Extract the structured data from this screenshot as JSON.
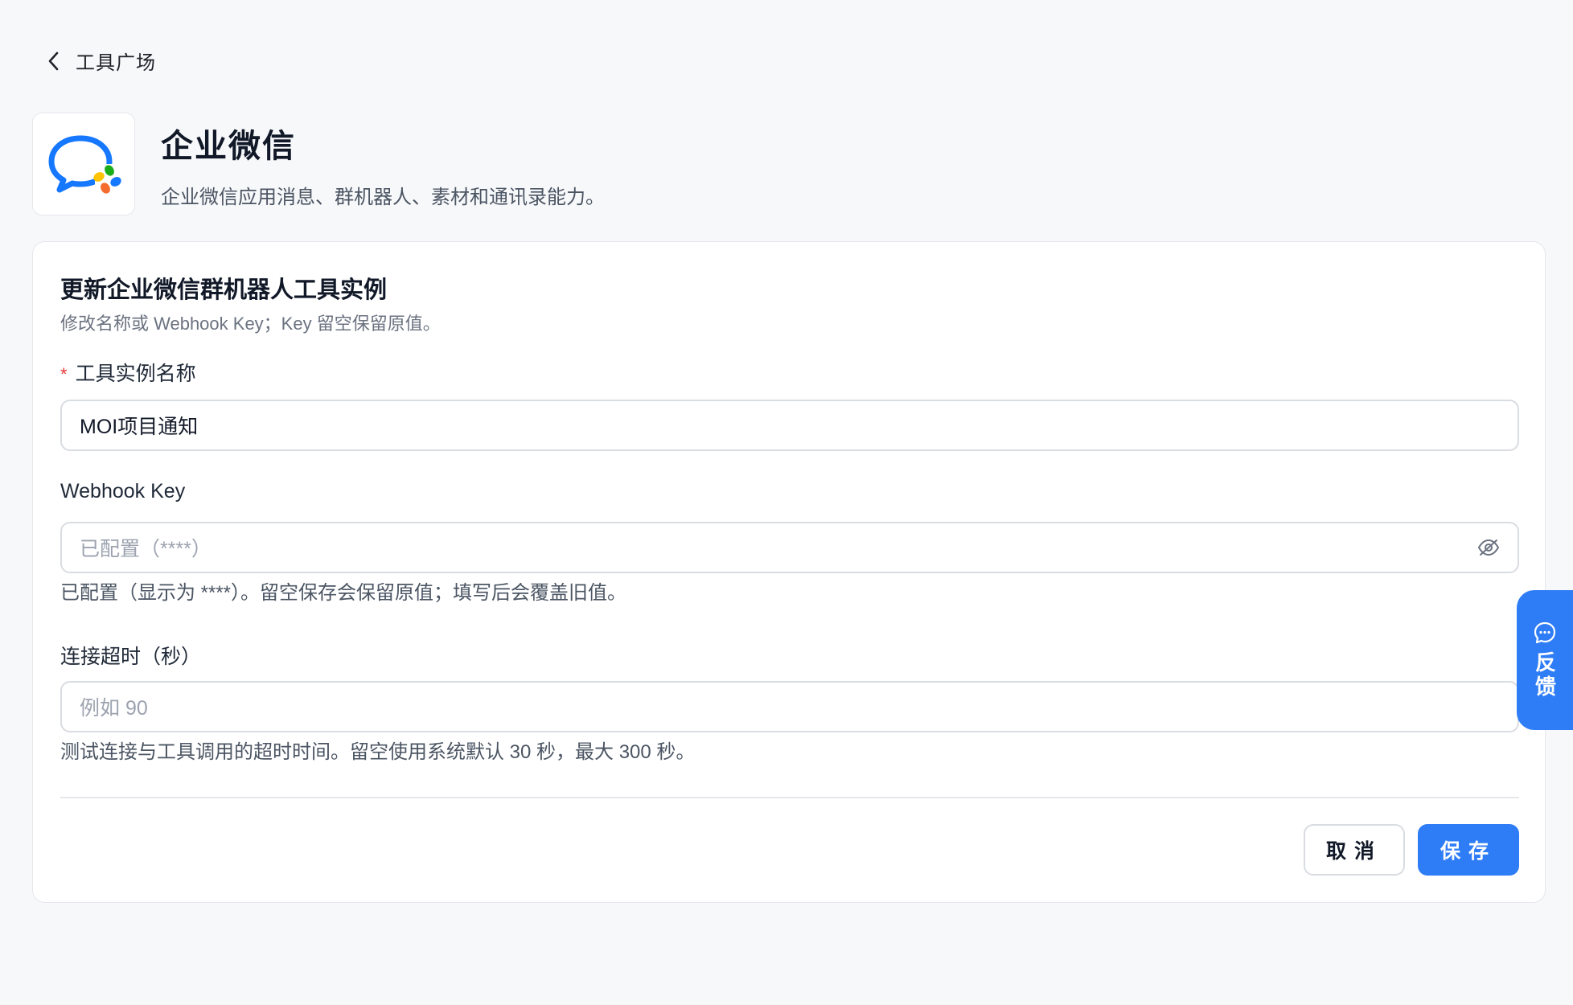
{
  "nav": {
    "back_label": "工具广场"
  },
  "app": {
    "title": "企业微信",
    "description": "企业微信应用消息、群机器人、素材和通讯录能力。",
    "logo_icon": "wecom-logo-icon"
  },
  "form": {
    "title": "更新企业微信群机器人工具实例",
    "subtitle": "修改名称或 Webhook Key；Key 留空保留原值。",
    "name_field": {
      "required_mark": "*",
      "label": "工具实例名称",
      "value": "MOI项目通知"
    },
    "webhook_field": {
      "label": "Webhook Key",
      "placeholder": "已配置（****）",
      "hint": "已配置（显示为 ****）。留空保存会保留原值；填写后会覆盖旧值。",
      "toggle_icon": "eye-off-icon"
    },
    "timeout_field": {
      "label": "连接超时（秒）",
      "placeholder": "例如 90",
      "hint": "测试连接与工具调用的超时时间。留空使用系统默认 30 秒，最大 300 秒。"
    },
    "cancel_label": "取消",
    "save_label": "保存"
  },
  "feedback": {
    "label": "反馈",
    "icon": "chat-bubble-icon"
  },
  "colors": {
    "primary": "#2f7df6",
    "required": "#e53935",
    "page_bg": "#f7f8fa"
  }
}
